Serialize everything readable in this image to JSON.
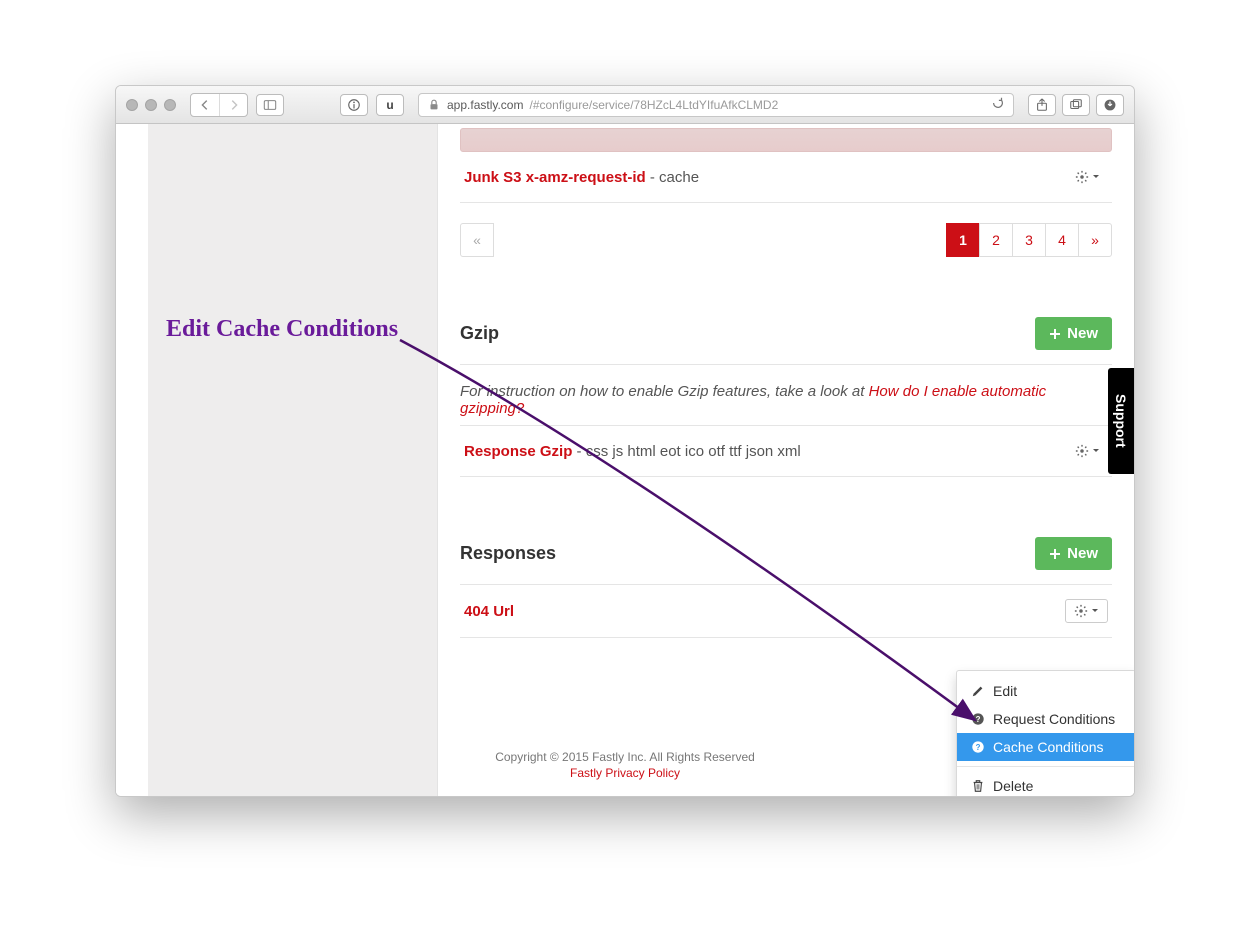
{
  "browser": {
    "url_host": "app.fastly.com",
    "url_path": "/#configure/service/78HZcL4LtdYIfuAfkCLMD2",
    "tab_info_label": "u"
  },
  "annotation": {
    "text": "Edit Cache Conditions"
  },
  "headers_section": {
    "item": {
      "name": "Junk S3 x-amz-request-id",
      "desc": " - cache"
    }
  },
  "pagination": {
    "prev": "«",
    "pages": [
      "1",
      "2",
      "3",
      "4"
    ],
    "next": "»",
    "active": "1"
  },
  "gzip_section": {
    "title": "Gzip",
    "new_label": "New",
    "instruction_pre": "For instruction on how to enable Gzip features, take a look at ",
    "instruction_link": "How do I enable automatic gzipping?",
    "item": {
      "name": "Response Gzip",
      "desc": " - css js html eot ico otf ttf json xml"
    }
  },
  "responses_section": {
    "title": "Responses",
    "new_label": "New",
    "item": {
      "name": "404 Url"
    }
  },
  "dropdown": {
    "edit": "Edit",
    "request_conditions": "Request Conditions",
    "cache_conditions": "Cache Conditions",
    "delete": "Delete"
  },
  "support_tab": "Support",
  "footer": {
    "copyright": "Copyright © 2015 Fastly Inc. All Rights Reserved",
    "privacy": "Fastly Privacy Policy"
  }
}
